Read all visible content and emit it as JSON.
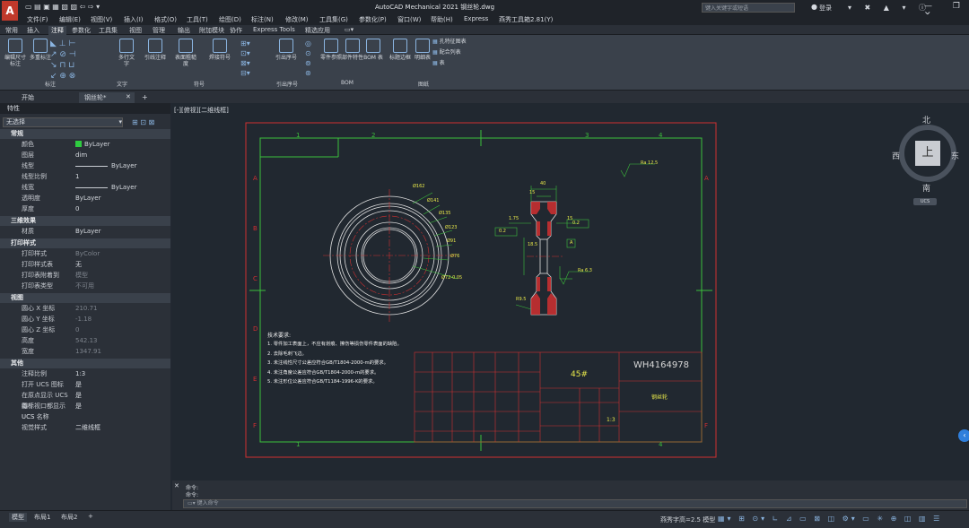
{
  "window": {
    "title": "AutoCAD Mechanical 2021     钢丝轮.dwg",
    "search_placeholder": "键入关键字或短语",
    "login": "登录",
    "logo": "A"
  },
  "menu": [
    "文件(F)",
    "编辑(E)",
    "视图(V)",
    "插入(I)",
    "格式(O)",
    "工具(T)",
    "绘图(D)",
    "标注(N)",
    "修改(M)",
    "工具集(G)",
    "参数化(P)",
    "窗口(W)",
    "帮助(H)",
    "Express",
    "燕秀工具箱2.81(Y)"
  ],
  "ribbon_tabs": [
    "常用",
    "插入",
    "注释",
    "参数化",
    "工具集",
    "视图",
    "管理",
    "输出",
    "附加模块",
    "协作",
    "Express Tools",
    "精选应用"
  ],
  "ribbon_active": "注释",
  "ribbon_buttons": [
    "编辑尺寸标注",
    "多重标注",
    "多行文字",
    "引线注释",
    "表面粗糙度",
    "焊接符号",
    "引出序号",
    "零件参照",
    "部件特性",
    "BOM 表",
    "标题边框",
    "明细表",
    "孔特征图表",
    "配合列表",
    "表"
  ],
  "ribbon_groups": [
    "标注",
    "文字",
    "符号",
    "引出序号",
    "BOM",
    "图纸"
  ],
  "doc_tabs": [
    "开始",
    "钢丝轮*"
  ],
  "properties": {
    "title": "特性",
    "selection": "无选择",
    "sections": [
      {
        "name": "常规",
        "rows": [
          [
            "颜色",
            "ByLayer"
          ],
          [
            "图层",
            "dim"
          ],
          [
            "线型",
            "ByLayer"
          ],
          [
            "线型比例",
            "1"
          ],
          [
            "线宽",
            "ByLayer"
          ],
          [
            "透明度",
            "ByLayer"
          ],
          [
            "厚度",
            "0"
          ]
        ]
      },
      {
        "name": "三维效果",
        "rows": [
          [
            "材质",
            "ByLayer"
          ]
        ]
      },
      {
        "name": "打印样式",
        "rows": [
          [
            "打印样式",
            "ByColor"
          ],
          [
            "打印样式表",
            "无"
          ],
          [
            "打印表附着到",
            "模型"
          ],
          [
            "打印表类型",
            "不可用"
          ]
        ]
      },
      {
        "name": "视图",
        "rows": [
          [
            "圆心 X 坐标",
            "210.71"
          ],
          [
            "圆心 Y 坐标",
            "-1.18"
          ],
          [
            "圆心 Z 坐标",
            "0"
          ],
          [
            "高度",
            "542.13"
          ],
          [
            "宽度",
            "1347.91"
          ]
        ]
      },
      {
        "name": "其他",
        "rows": [
          [
            "注释比例",
            "1:3"
          ],
          [
            "打开 UCS 图标",
            "是"
          ],
          [
            "在原点显示 UCS 图标",
            "是"
          ],
          [
            "每个视口都显示 UCS",
            "是"
          ],
          [
            "UCS 名称",
            ""
          ],
          [
            "视觉样式",
            "二维线框"
          ]
        ]
      }
    ]
  },
  "viewport_label": "[-][俯视][二维线框]",
  "viewcube": {
    "n": "北",
    "s": "南",
    "e": "东",
    "w": "西",
    "top": "上",
    "ucs": "UCS"
  },
  "drawing": {
    "zone_nums": [
      "1",
      "2",
      "3",
      "4"
    ],
    "zone_letters": [
      "A",
      "B",
      "C",
      "D",
      "E",
      "F"
    ],
    "tech_title": "技术要求:",
    "tech_reqs": [
      "1.    零件加工表面上，不应有划痕、擦伤等损伤零件表面的缺陷。",
      "2.    去除毛刺飞边。",
      "3.    未注线性尺寸公差应符合GB/T1804-2000-m的要求。",
      "4.    未注角度公差应符合GB/T1804-2000-m的要求。",
      "5.    未注形位公差应符合GB/T1184-1996-K的要求。"
    ],
    "material": "45#",
    "drawing_no": "WH4164978",
    "part_name": "钢丝轮",
    "scale": "1:3",
    "dims": [
      "Ø162",
      "Ø141",
      "Ø135",
      "Ø123",
      "Ø91",
      "Ø76",
      "Ø72-0.05",
      "40",
      "15",
      "1.75",
      "15",
      "18.5",
      "R9.5",
      "Ra 12.5",
      "Ra 6.3",
      "0.2",
      "A",
      "0.2"
    ]
  },
  "command": {
    "line1": "命令:",
    "line2": "命令:",
    "placeholder": "键入命令"
  },
  "status_tabs": [
    "模型",
    "布局1",
    "布局2"
  ],
  "status_right": "燕秀字高=2.5   模型"
}
